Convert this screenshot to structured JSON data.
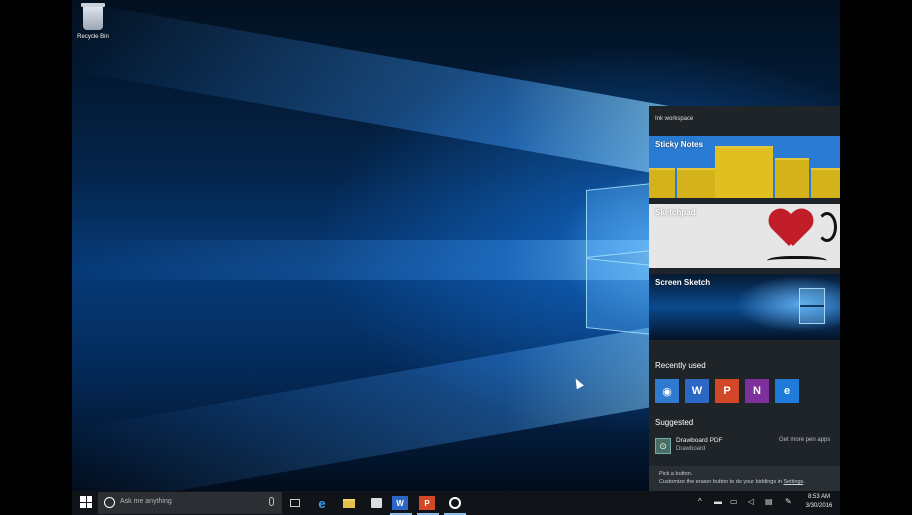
{
  "desktop": {
    "icons": [
      {
        "label": "Recycle Bin",
        "icon": "recycle-bin-icon"
      }
    ]
  },
  "ink_workspace": {
    "title": "Ink workspace",
    "tiles": [
      {
        "label": "Sticky Notes"
      },
      {
        "label": "Sketchpad"
      },
      {
        "label": "Screen Sketch"
      }
    ],
    "recently_used": {
      "heading": "Recently used",
      "apps": [
        {
          "name": "ink-app",
          "glyph": "◉",
          "color": "#2e7bd0"
        },
        {
          "name": "word",
          "glyph": "W",
          "color": "#2b67c4"
        },
        {
          "name": "powerpoint",
          "glyph": "P",
          "color": "#d24726"
        },
        {
          "name": "onenote",
          "glyph": "N",
          "color": "#7d2f9b"
        },
        {
          "name": "edge",
          "glyph": "e",
          "color": "#1f7bd8"
        }
      ]
    },
    "suggested": {
      "heading": "Suggested",
      "item_name": "Drawboard PDF",
      "item_publisher": "Drawboard",
      "more_link": "Get more pen apps"
    },
    "footer": {
      "line1": "Pick a button.",
      "line2_prefix": "Customize the eraser button to do your biddings in ",
      "line2_link": "Settings",
      "line2_suffix": "."
    }
  },
  "taskbar": {
    "search_placeholder": "Ask me anything",
    "pinned": [
      {
        "name": "task-view"
      },
      {
        "name": "edge",
        "glyph": "e"
      },
      {
        "name": "file-explorer"
      },
      {
        "name": "store"
      },
      {
        "name": "word",
        "glyph": "W"
      },
      {
        "name": "powerpoint",
        "glyph": "P"
      },
      {
        "name": "ink-app"
      }
    ],
    "tray": {
      "chevron": "^",
      "time": "8:53 AM",
      "date": "3/30/2016"
    }
  }
}
